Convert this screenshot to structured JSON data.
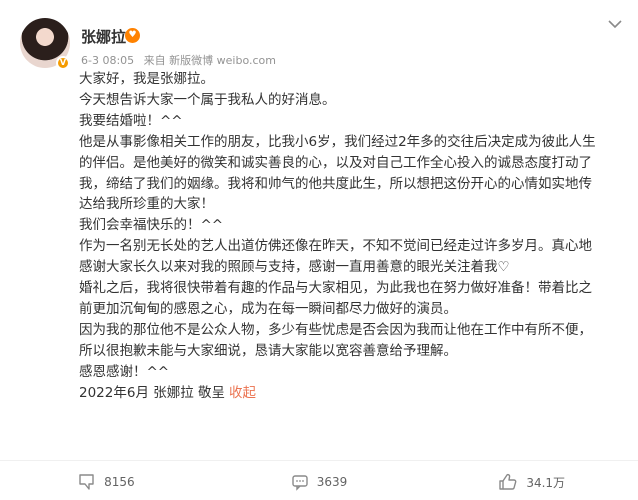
{
  "author": {
    "name": "张娜拉",
    "badge_icon": "heart-eyes-emoji",
    "verified_icon": "verified-v-icon"
  },
  "meta": {
    "date": "6-3 08:05",
    "source": "来自 新版微博 weibo.com"
  },
  "post": {
    "lines": [
      "大家好，我是张娜拉。",
      "今天想告诉大家一个属于我私人的好消息。",
      "我要结婚啦！^^",
      "他是从事影像相关工作的朋友，比我小6岁，我们经过2年多的交往后决定成为彼此人生",
      "的伴侣。是他美好的微笑和诚实善良的心，以及对自己工作全心投入的诚恳态度打动了",
      "我，缔结了我们的姻缘。我将和帅气的他共度此生，所以想把这份开心的心情如实地传",
      "达给我所珍重的大家！",
      "我们会幸福快乐的！^^",
      "作为一名别无长处的艺人出道仿佛还像在昨天，不知不觉间已经走过许多岁月。真心地",
      "感谢大家长久以来对我的照顾与支持，感谢一直用善意的眼光关注着我♡",
      "婚礼之后，我将很快带着有趣的作品与大家相见，为此我也在努力做好准备！带着比之",
      "前更加沉甸甸的感恩之心，成为在每一瞬间都尽力做好的演员。",
      "因为我的那位他不是公众人物，多少有些忧虑是否会因为我而让他在工作中有所不便，",
      "所以很抱歉未能与大家细说，恳请大家能以宽容善意给予理解。",
      "感恩感谢！^^"
    ],
    "signature": "2022年6月 张娜拉 敬呈",
    "collapse_label": "收起"
  },
  "actions": {
    "repost": "8156",
    "comment": "3639",
    "like": "34.1万"
  },
  "colors": {
    "link": "#eb7350",
    "meta": "#939393"
  }
}
